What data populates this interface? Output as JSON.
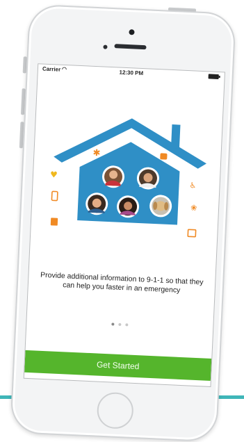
{
  "status_bar": {
    "carrier": "Carrier",
    "wifi_icon": "wifi-icon",
    "time": "12:30 PM",
    "battery_icon": "battery-icon"
  },
  "illustration": {
    "house_color": "#2f8fc6",
    "accent_color": "#f08a24",
    "icons": [
      "asterisk-icon",
      "heart-icon",
      "cup-icon",
      "wheelchair-icon",
      "phone-icon",
      "paw-icon",
      "medical-kit-icon",
      "person-badge-icon"
    ]
  },
  "onboarding": {
    "caption": "Provide additional information to 9-1-1 so that they can help you faster in an emergency",
    "page_count": 3,
    "active_page": 1
  },
  "cta": {
    "label": "Get Started",
    "color": "#55b52c"
  }
}
